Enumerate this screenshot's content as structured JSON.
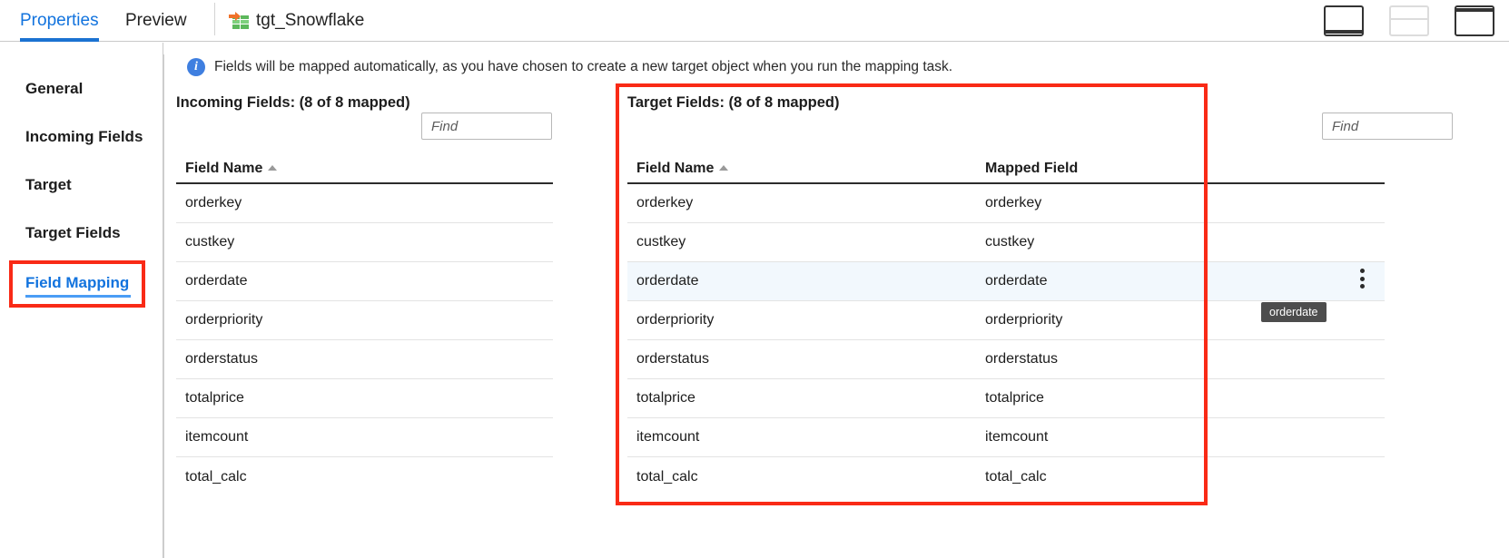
{
  "tabs": [
    {
      "id": "properties",
      "label": "Properties",
      "active": true
    },
    {
      "id": "preview",
      "label": "Preview",
      "active": false
    }
  ],
  "target_tab": {
    "label": "tgt_Snowflake",
    "icon": "snowflake-target-table-icon"
  },
  "layout_buttons": [
    {
      "id": "bottom-panel",
      "icon": "panel-bottom-icon",
      "state": "enabled"
    },
    {
      "id": "split-panel",
      "icon": "panel-split-icon",
      "state": "disabled"
    },
    {
      "id": "top-panel",
      "icon": "panel-top-icon",
      "state": "enabled"
    }
  ],
  "info_banner": {
    "icon": "info-icon",
    "symbol": "i",
    "text": "Fields will be mapped automatically, as you have chosen to create a new target object when you run the mapping task."
  },
  "sidebar": {
    "items": [
      {
        "id": "general",
        "label": "General",
        "active": false
      },
      {
        "id": "incoming-fields",
        "label": "Incoming Fields",
        "active": false
      },
      {
        "id": "target",
        "label": "Target",
        "active": false
      },
      {
        "id": "target-fields",
        "label": "Target Fields",
        "active": false
      },
      {
        "id": "field-mapping",
        "label": "Field Mapping",
        "active": true
      }
    ]
  },
  "incoming_panel": {
    "title": "Incoming Fields: (8 of 8 mapped)",
    "find_placeholder": "Find",
    "find_value": "",
    "columns": [
      {
        "id": "field-name",
        "label": "Field Name",
        "sort": "asc"
      }
    ],
    "rows": [
      {
        "field_name": "orderkey"
      },
      {
        "field_name": "custkey"
      },
      {
        "field_name": "orderdate"
      },
      {
        "field_name": "orderpriority"
      },
      {
        "field_name": "orderstatus"
      },
      {
        "field_name": "totalprice"
      },
      {
        "field_name": "itemcount"
      },
      {
        "field_name": "total_calc"
      }
    ]
  },
  "target_panel": {
    "title": "Target Fields: (8 of 8 mapped)",
    "find_placeholder": "Find",
    "find_value": "",
    "columns": [
      {
        "id": "field-name",
        "label": "Field Name",
        "sort": "asc"
      },
      {
        "id": "mapped-field",
        "label": "Mapped Field",
        "sort": "none"
      }
    ],
    "rows": [
      {
        "field_name": "orderkey",
        "mapped_field": "orderkey",
        "selected": false
      },
      {
        "field_name": "custkey",
        "mapped_field": "custkey",
        "selected": false
      },
      {
        "field_name": "orderdate",
        "mapped_field": "orderdate",
        "selected": true
      },
      {
        "field_name": "orderpriority",
        "mapped_field": "orderpriority",
        "selected": false
      },
      {
        "field_name": "orderstatus",
        "mapped_field": "orderstatus",
        "selected": false
      },
      {
        "field_name": "totalprice",
        "mapped_field": "totalprice",
        "selected": false
      },
      {
        "field_name": "itemcount",
        "mapped_field": "itemcount",
        "selected": false
      },
      {
        "field_name": "total_calc",
        "mapped_field": "total_calc",
        "selected": false
      }
    ],
    "row_menu_icon": "kebab-menu-icon"
  },
  "tooltip": {
    "text": "orderdate"
  },
  "annotations": {
    "highlight_color": "#f92a16",
    "sidebar_highlight_target": "field-mapping",
    "panel_highlight_target": "target-panel"
  },
  "colors": {
    "accent_blue": "#1273de",
    "tab_underline": "#1b72d1",
    "selected_row": "#f2f8fd",
    "info_blue": "#3f7fe0",
    "tooltip_bg": "#4d4d4d"
  }
}
